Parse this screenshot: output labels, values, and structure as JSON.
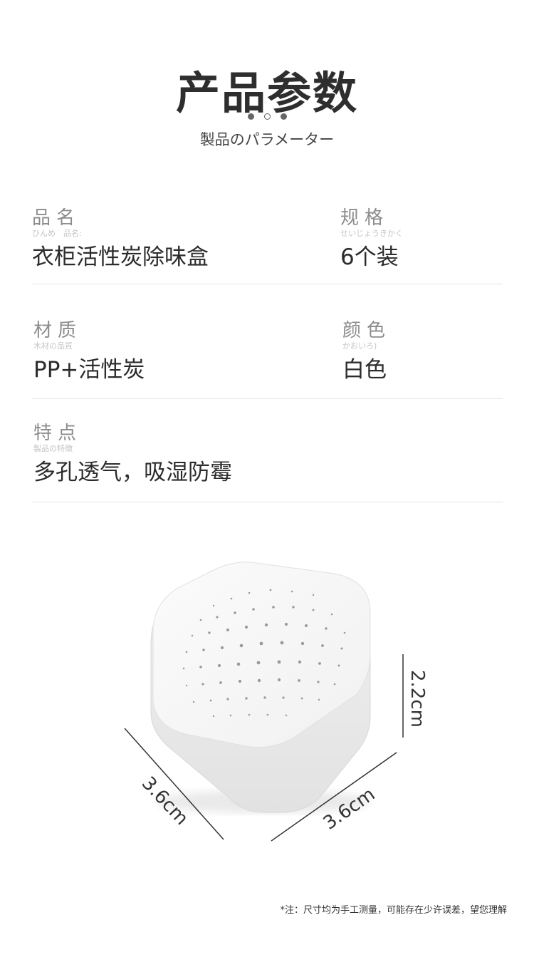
{
  "header": {
    "title": "产品参数",
    "subtitle": "製品のパラメーター"
  },
  "params": {
    "name": {
      "label": "品名",
      "sublabel": "ひんめ　品名:",
      "value": "衣柜活性炭除味盒"
    },
    "spec": {
      "label": "规格",
      "sublabel": "せいじょうきかく",
      "value": "6个装"
    },
    "material": {
      "label": "材质",
      "sublabel": "木材の品質",
      "value": "PP+活性炭"
    },
    "color": {
      "label": "颜色",
      "sublabel": "かおいろ)",
      "value": "白色"
    },
    "feature": {
      "label": "特点",
      "sublabel": "製品の特徴",
      "value": "多孔透气，吸湿防霉"
    }
  },
  "dimensions": {
    "left_length": "3.6cm",
    "right_length": "3.6cm",
    "height": "2.2cm"
  },
  "note": "*注：尺寸均为手工测量，可能存在少许误差，望您理解",
  "colors": {
    "text_dark": "#2c2c2c",
    "label_gray": "#8c8c8c",
    "divider": "#e6e6e6",
    "product_white": "#f4f4f4"
  },
  "icons": {
    "pagination": "pagination-dots"
  }
}
